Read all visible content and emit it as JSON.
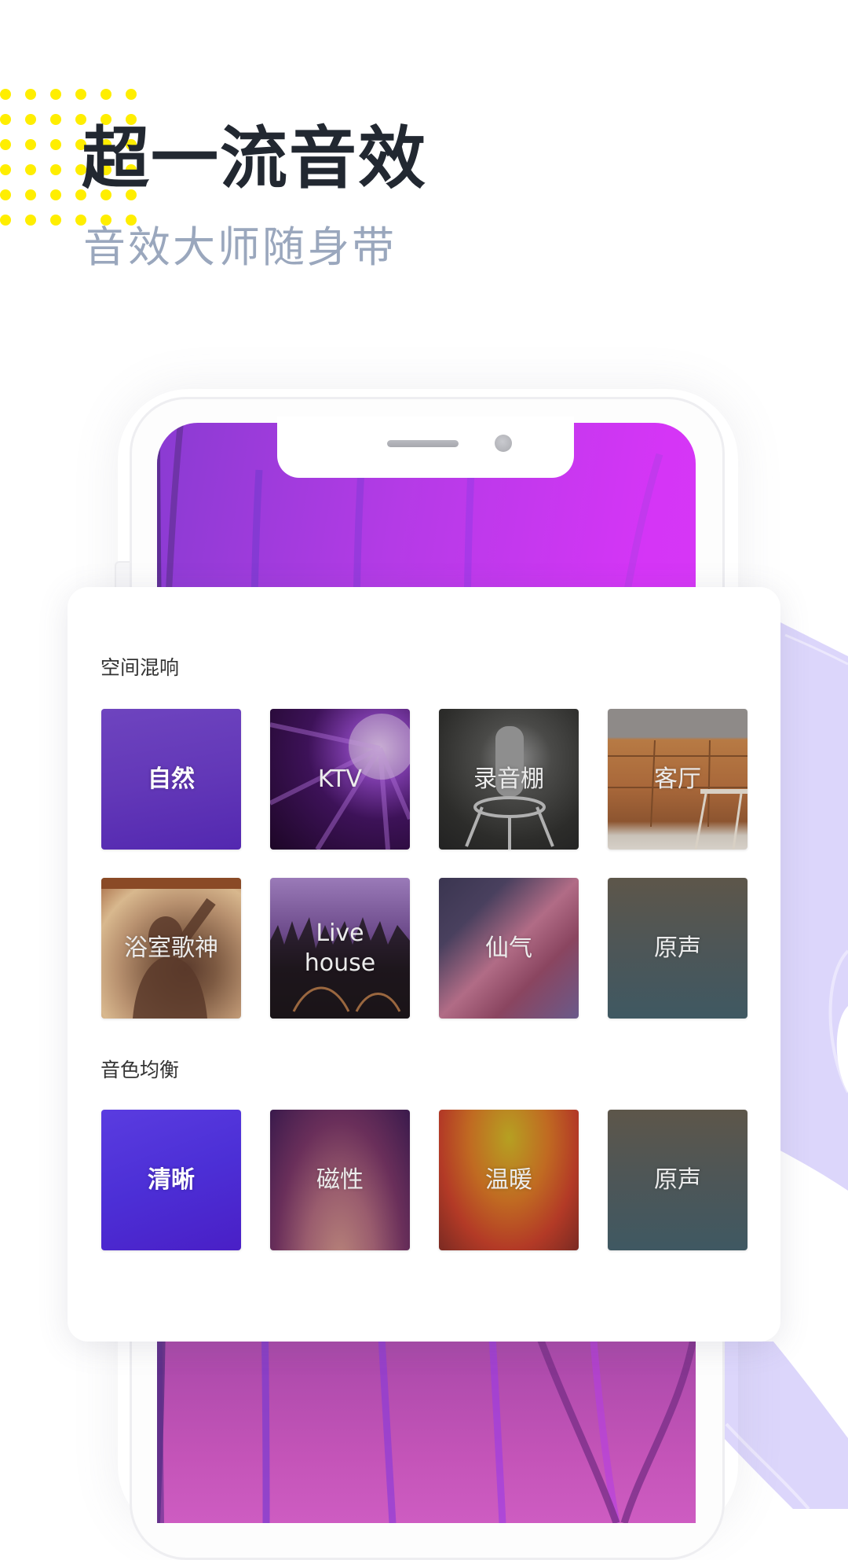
{
  "hero": {
    "title": "超一流音效",
    "subtitle": "音效大师随身带"
  },
  "colors": {
    "accent_dots": "#ffee00",
    "title_text": "#222831",
    "subtitle_text": "#9aa7bd",
    "screen_gradient_start": "#8a3bd2",
    "screen_gradient_end": "#d83af5",
    "decor_lavender": "#dcd6fb"
  },
  "panel": {
    "sections": [
      {
        "label": "空间混响",
        "presets": [
          {
            "label": "自然",
            "selected": true,
            "image": "purple-texture"
          },
          {
            "label": "KTV",
            "selected": false,
            "image": "disco-ball"
          },
          {
            "label": "录音棚",
            "selected": false,
            "image": "studio-microphone"
          },
          {
            "label": "客厅",
            "selected": false,
            "image": "leather-sofa"
          },
          {
            "label": "浴室歌神",
            "selected": false,
            "image": "shower-singer-silhouette"
          },
          {
            "label": "Live house",
            "selected": false,
            "image": "concert-crowd"
          },
          {
            "label": "仙气",
            "selected": false,
            "image": "pink-smoke"
          },
          {
            "label": "原声",
            "selected": false,
            "image": "gray-teal-gradient"
          }
        ]
      },
      {
        "label": "音色均衡",
        "presets": [
          {
            "label": "清晰",
            "selected": true,
            "image": "blue-violet-gradient"
          },
          {
            "label": "磁性",
            "selected": false,
            "image": "plum-gradient"
          },
          {
            "label": "温暖",
            "selected": false,
            "image": "amber-red-gradient"
          },
          {
            "label": "原声",
            "selected": false,
            "image": "gray-teal-gradient"
          }
        ]
      }
    ]
  }
}
